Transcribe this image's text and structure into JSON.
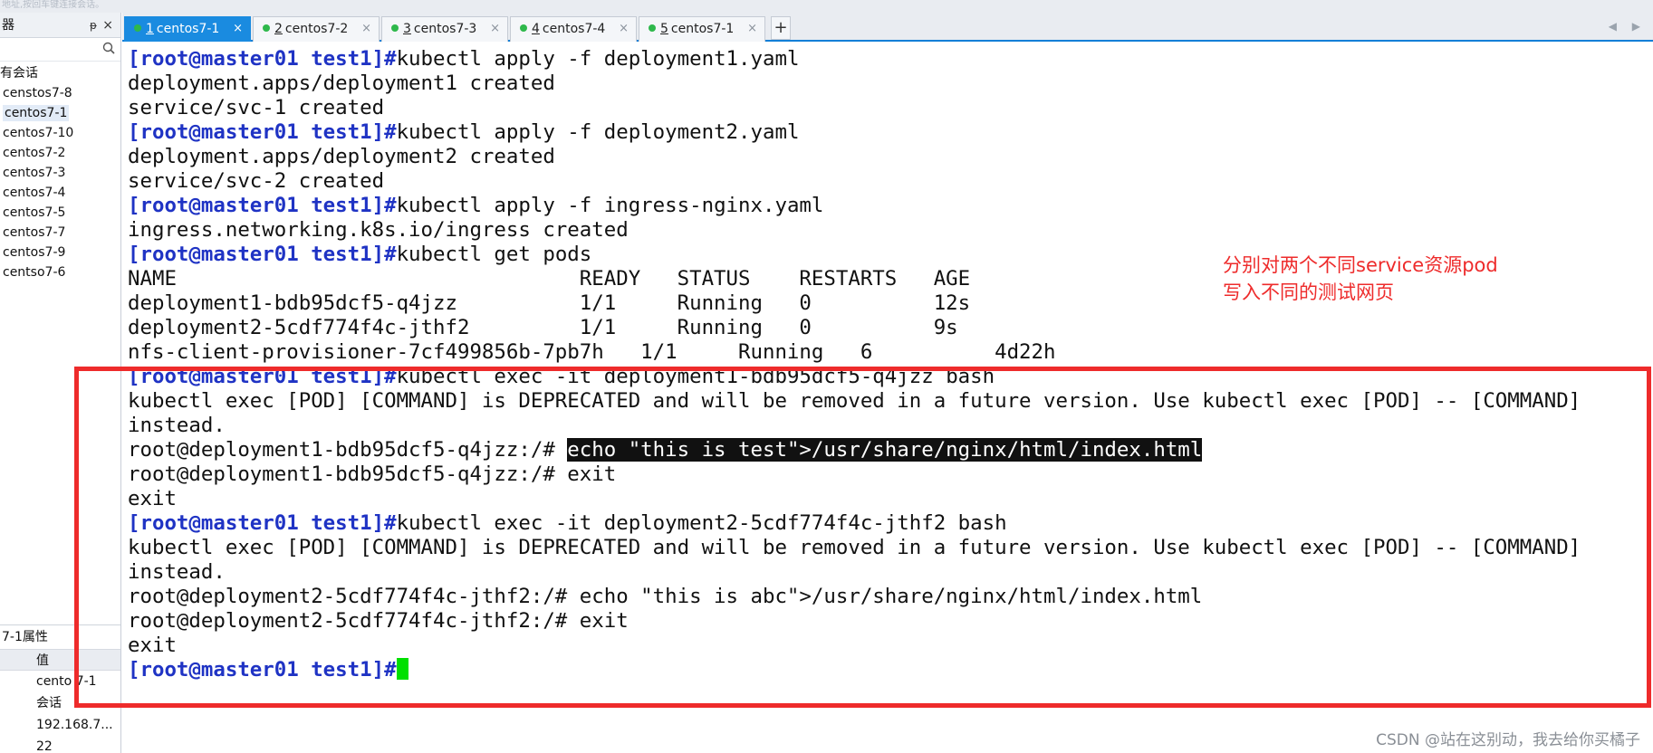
{
  "topbar": {
    "hint": "地址,按回车键连接会话。"
  },
  "sidebar": {
    "title": "器",
    "pin": "ᵽ",
    "close": "×",
    "root_label": "有会话",
    "sessions": [
      "censtos7-8",
      "centos7-1",
      "centos7-10",
      "centos7-2",
      "centos7-3",
      "centos7-4",
      "centos7-5",
      "centos7-7",
      "centos7-9",
      "centso7-6"
    ],
    "selected": "centos7-1",
    "props_title": "7-1属性",
    "props_header": "值",
    "props_values": [
      "cento 7-1",
      "会话",
      "192.168.7...",
      "22"
    ]
  },
  "tabs": [
    {
      "num": "1",
      "name": "centos7-1",
      "active": true
    },
    {
      "num": "2",
      "name": "centos7-2",
      "active": false
    },
    {
      "num": "3",
      "name": "centos7-3",
      "active": false
    },
    {
      "num": "4",
      "name": "centos7-4",
      "active": false
    },
    {
      "num": "5",
      "name": "centos7-1",
      "active": false
    }
  ],
  "tab_add": "+",
  "tab_nav": {
    "left": "◀",
    "right": "▶"
  },
  "terminal": {
    "prompt": "[root@master01 test1]#",
    "lines": {
      "l1_cmd": "kubectl apply -f deployment1.yaml",
      "l2": "deployment.apps/deployment1 created",
      "l3": "service/svc-1 created",
      "l4_cmd": "kubectl apply -f deployment2.yaml",
      "l5": "deployment.apps/deployment2 created",
      "l6": "service/svc-2 created",
      "l7_cmd": "kubectl apply -f ingress-nginx.yaml",
      "l8": "ingress.networking.k8s.io/ingress created",
      "l9_cmd": "kubectl get pods",
      "l10": "NAME                                 READY   STATUS    RESTARTS   AGE",
      "l11": "deployment1-bdb95dcf5-q4jzz          1/1     Running   0          12s",
      "l12": "deployment2-5cdf774f4c-jthf2         1/1     Running   0          9s",
      "l13": "nfs-client-provisioner-7cf499856b-7pb7h   1/1     Running   6          4d22h",
      "l14_cmd": "kubectl exec -it deployment1-bdb95dcf5-q4jzz bash",
      "l15": "kubectl exec [POD] [COMMAND] is DEPRECATED and will be removed in a future version. Use kubectl exec [POD] -- [COMMAND]",
      "l16": "instead.",
      "l17_prompt": "root@deployment1-bdb95dcf5-q4jzz:/# ",
      "l17_cmd": "echo \"this is test\">/usr/share/nginx/html/index.html",
      "l18": "root@deployment1-bdb95dcf5-q4jzz:/# exit",
      "l19": "exit",
      "l20_cmd": "kubectl exec -it deployment2-5cdf774f4c-jthf2 bash",
      "l21": "kubectl exec [POD] [COMMAND] is DEPRECATED and will be removed in a future version. Use kubectl exec [POD] -- [COMMAND]",
      "l22": "instead.",
      "l23": "root@deployment2-5cdf774f4c-jthf2:/# echo \"this is abc\">/usr/share/nginx/html/index.html",
      "l24": "root@deployment2-5cdf774f4c-jthf2:/# exit",
      "l25": "exit"
    },
    "cursor_color": "#00e000",
    "prompt_color": "#1f33c4"
  },
  "annotation": {
    "note_line1": "分别对两个不同service资源pod",
    "note_line2": "写入不同的测试网页",
    "box_color": "#ee2b2b"
  },
  "watermark": "CSDN @站在这别动，我去给你买橘子"
}
